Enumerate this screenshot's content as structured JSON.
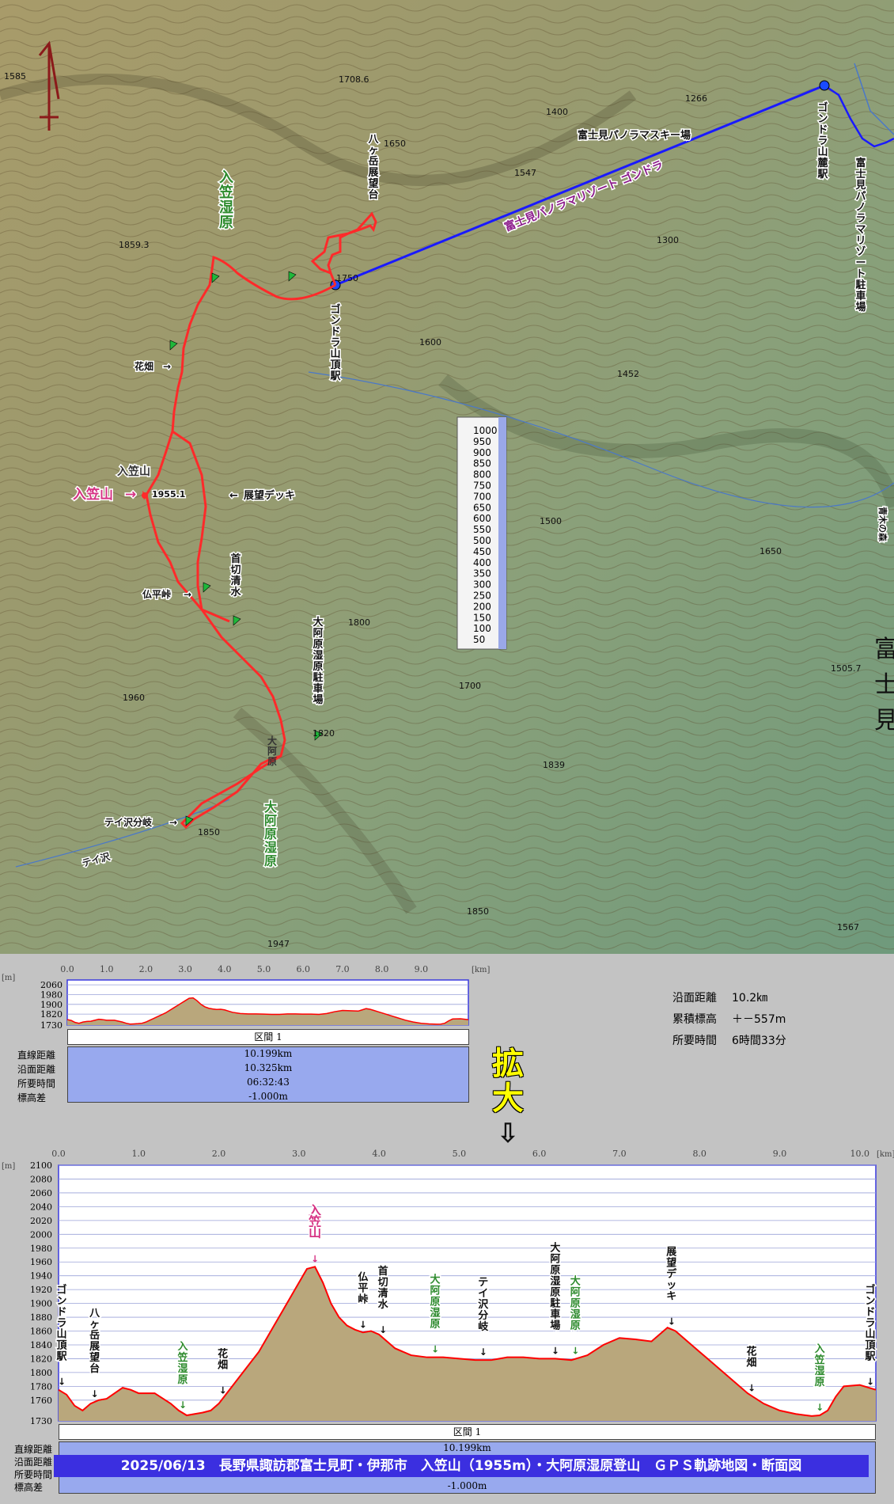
{
  "title_banner": "2025/06/13　長野県諏訪郡富士見町・伊那市　入笠山（1955m）・大阿原湿原登山　ＧＰＳ軌跡地図・断面図",
  "map": {
    "labels": {
      "gondola_top": "ゴンドラ山頂駅",
      "gondola_base": "ゴンドラ山麓駅",
      "parking": "富士見パノラマリゾート駐車場",
      "gondola_line": "富士見パノラマリゾート ゴンドラ",
      "ski_area": "富士見パノラマスキー場",
      "yatsu_view": "八ヶ岳展望台",
      "nyukasa_marsh": "入笠湿原",
      "hanabatake": "花畑",
      "nyukasa_summit": "入笠山",
      "summit_elev": "1955.1",
      "view_deck": "展望デッキ",
      "buppei": "仏平峠",
      "kubikiri": "首切清水",
      "oahara_parking": "大阿原湿原駐車場",
      "teizawa": "テイ沢分岐",
      "oahara_marsh": "大阿原湿原",
      "marsh_small": "大阿原",
      "town": "富士見町",
      "aoki": "青木の森",
      "mt_small": "入笠山",
      "teizawa_river": "テイ沢"
    },
    "elevations": [
      "1585",
      "1708.6",
      "1859.3",
      "1266",
      "1400",
      "1547",
      "1600",
      "1452",
      "1500",
      "1650",
      "1800",
      "1960",
      "1820",
      "1839",
      "1850",
      "1947",
      "1567",
      "1505.7",
      "1300",
      "1750",
      "1700",
      "1650",
      "1850"
    ],
    "legend_scale": [
      "1000",
      "950",
      "900",
      "850",
      "800",
      "750",
      "700",
      "650",
      "600",
      "550",
      "500",
      "450",
      "400",
      "350",
      "300",
      "250",
      "200",
      "150",
      "100",
      "50"
    ],
    "colors": {
      "track": "#ff0000",
      "gondola": "#1a1aff",
      "label_green": "#2e8b2e",
      "label_pink": "#d63384"
    }
  },
  "summary": {
    "distance_label": "沿面距離",
    "distance_value": "10.2㎞",
    "gain_label": "累積標高",
    "gain_value": "＋－557m",
    "time_label": "所要時間",
    "time_value": "6時間33分"
  },
  "expand_label": "拡大",
  "expand_arrow": "⇩",
  "small_profile": {
    "km_unit": "[km]",
    "m_unit": "[m]",
    "x_ticks": [
      "0.0",
      "1.0",
      "2.0",
      "3.0",
      "4.0",
      "5.0",
      "6.0",
      "7.0",
      "8.0",
      "9.0"
    ],
    "y_ticks": [
      "2060",
      "1980",
      "1900",
      "1820",
      "1730"
    ],
    "section_label": "区間 1",
    "rows": [
      {
        "label": "直線距離",
        "value": "10.199km"
      },
      {
        "label": "沿面距離",
        "value": "10.325km"
      },
      {
        "label": "所要時間",
        "value": "06:32:43"
      },
      {
        "label": "標高差",
        "value": "-1.000m"
      }
    ]
  },
  "large_profile": {
    "km_unit": "[km]",
    "m_unit": "[m]",
    "section_label": "区間 1",
    "rows": [
      {
        "label": "直線距離",
        "value": "10.199km"
      },
      {
        "label": "沿面距離",
        "value": "10.325km"
      },
      {
        "label": "所要時間",
        "value": "06:32:43"
      },
      {
        "label": "標高差",
        "value": "-1.000m"
      }
    ]
  },
  "chart_data": {
    "type": "area",
    "title": "",
    "xlabel": "[km]",
    "ylabel": "[m]",
    "xlim": [
      0,
      10.2
    ],
    "ylim": [
      1730,
      2100
    ],
    "x_ticks": [
      "0.0",
      "1.0",
      "2.0",
      "3.0",
      "4.0",
      "5.0",
      "6.0",
      "7.0",
      "8.0",
      "9.0",
      "10.0"
    ],
    "y_ticks": [
      "2100",
      "2080",
      "2060",
      "2040",
      "2020",
      "2000",
      "1980",
      "1960",
      "1940",
      "1920",
      "1900",
      "1880",
      "1860",
      "1840",
      "1820",
      "1800",
      "1780",
      "1760",
      "1730"
    ],
    "grid": true,
    "series": [
      {
        "x": [
          0.0,
          0.1,
          0.2,
          0.3,
          0.4,
          0.5,
          0.6,
          0.7,
          0.8,
          0.9,
          1.0,
          1.2,
          1.4,
          1.5,
          1.6,
          1.7,
          1.8,
          1.9,
          2.0,
          2.1,
          2.2,
          2.3,
          2.4,
          2.5,
          2.6,
          2.7,
          2.8,
          2.9,
          3.0,
          3.1,
          3.2,
          3.3,
          3.4,
          3.5,
          3.6,
          3.7,
          3.8,
          3.9,
          4.0,
          4.1,
          4.2,
          4.4,
          4.6,
          4.8,
          5.0,
          5.2,
          5.4,
          5.6,
          5.8,
          6.0,
          6.2,
          6.4,
          6.6,
          6.8,
          7.0,
          7.2,
          7.4,
          7.5,
          7.6,
          7.7,
          7.8,
          7.9,
          8.0,
          8.2,
          8.4,
          8.6,
          8.8,
          9.0,
          9.2,
          9.4,
          9.5,
          9.6,
          9.7,
          9.8,
          10.0,
          10.2
        ],
        "y": [
          1775,
          1768,
          1752,
          1745,
          1755,
          1760,
          1762,
          1770,
          1778,
          1775,
          1770,
          1770,
          1755,
          1745,
          1738,
          1740,
          1742,
          1745,
          1755,
          1770,
          1785,
          1800,
          1815,
          1830,
          1850,
          1870,
          1890,
          1910,
          1930,
          1950,
          1953,
          1930,
          1900,
          1880,
          1868,
          1862,
          1858,
          1860,
          1855,
          1845,
          1835,
          1825,
          1822,
          1822,
          1820,
          1818,
          1818,
          1822,
          1822,
          1820,
          1820,
          1818,
          1825,
          1840,
          1850,
          1848,
          1845,
          1855,
          1865,
          1860,
          1850,
          1840,
          1830,
          1810,
          1790,
          1770,
          1755,
          1745,
          1740,
          1737,
          1738,
          1745,
          1765,
          1780,
          1782,
          1775
        ]
      }
    ],
    "annotations": [
      {
        "x": 0.0,
        "text": "ゴンドラ山頂駅"
      },
      {
        "x": 0.45,
        "text": "八ヶ岳展望台"
      },
      {
        "x": 1.55,
        "text": "入笠湿原"
      },
      {
        "x": 2.05,
        "text": "花畑"
      },
      {
        "x": 3.2,
        "text": "入笠山"
      },
      {
        "x": 3.8,
        "text": "仏平峠"
      },
      {
        "x": 4.05,
        "text": "首切清水"
      },
      {
        "x": 4.7,
        "text": "大阿原湿原"
      },
      {
        "x": 5.3,
        "text": "テイ沢分岐"
      },
      {
        "x": 6.2,
        "text": "大阿原湿原駐車場"
      },
      {
        "x": 6.45,
        "text": "大阿原湿原"
      },
      {
        "x": 7.65,
        "text": "展望デッキ"
      },
      {
        "x": 8.65,
        "text": "花畑"
      },
      {
        "x": 9.5,
        "text": "入笠湿原"
      },
      {
        "x": 10.2,
        "text": "ゴンドラ山頂駅"
      }
    ]
  }
}
